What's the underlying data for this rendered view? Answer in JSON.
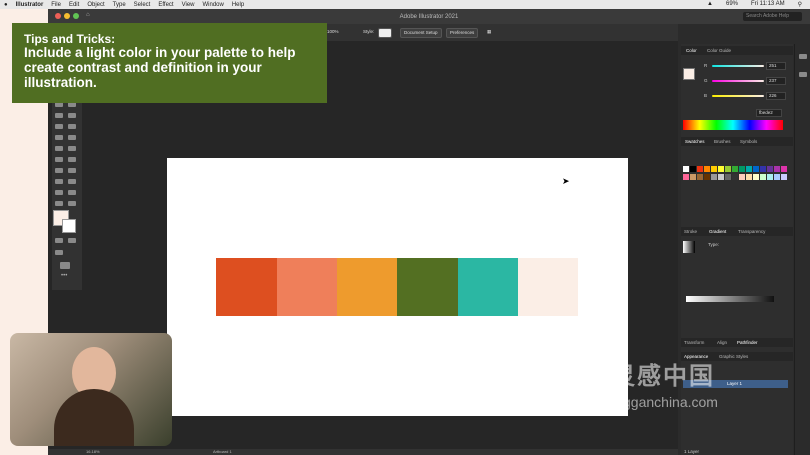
{
  "menubar": {
    "items": [
      "Illustrator",
      "File",
      "Edit",
      "Object",
      "Type",
      "Select",
      "Effect",
      "View",
      "Window",
      "Help"
    ],
    "battery": "69%",
    "clock": "Fri 11:13 AM"
  },
  "titlebar": {
    "title": "Adobe Illustrator 2021",
    "search_placeholder": "Search Adobe Help"
  },
  "controlbar": {
    "zoom": "100%",
    "style_label": "Style:",
    "document_setup": "Document Setup",
    "preferences": "Preferences"
  },
  "tips": {
    "title": "Tips and Tricks:",
    "body": "Include a light color in your palette to help create contrast and definition in your illustration."
  },
  "palette": {
    "colors": [
      "#dd4f20",
      "#ef7f5a",
      "#ee9b2d",
      "#536f22",
      "#2bb7a3",
      "#fbeee6"
    ]
  },
  "color_panel": {
    "tab_color": "Color",
    "tab_guide": "Color Guide",
    "r_label": "R",
    "r_value": "251",
    "g_label": "G",
    "g_value": "237",
    "b_label": "B",
    "b_value": "226",
    "hex_value": "fbede2"
  },
  "swatches_panel": {
    "tab_swatches": "Swatches",
    "tab_brushes": "Brushes",
    "tab_symbols": "Symbols"
  },
  "gradient_panel": {
    "tab_stroke": "Stroke",
    "tab_gradient": "Gradient",
    "tab_transparency": "Transparency",
    "type_label": "Type:"
  },
  "pathfinder_panel": {
    "tab_transform": "Transform",
    "tab_align": "Align",
    "tab_pathfinder": "Pathfinder"
  },
  "appearance_panel": {
    "tab_appearance": "Appearance",
    "tab_graphic_styles": "Graphic Styles"
  },
  "layers": {
    "layer_name": "Layer 1",
    "count": "1 Layer"
  },
  "statusbar": {
    "zoom": "16.18%",
    "artboard": "Artboard 1"
  },
  "watermark": {
    "cn": "灵感中国",
    "en": "lingganchina.com"
  }
}
